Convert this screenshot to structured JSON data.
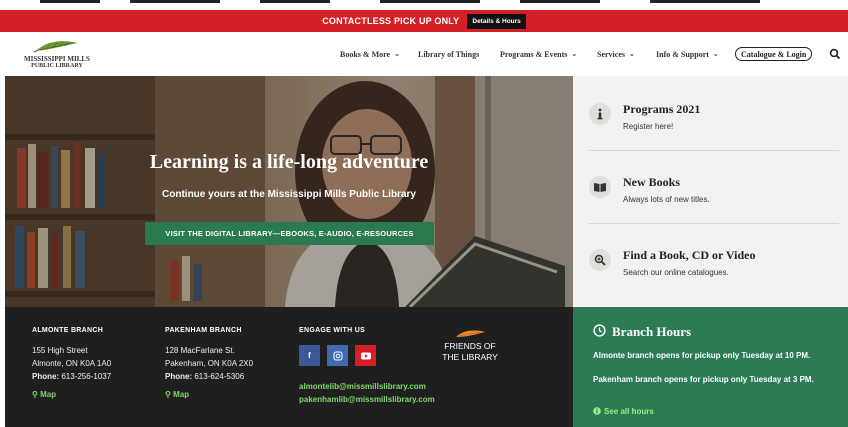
{
  "alert": {
    "message": "CONTACTLESS PICK UP ONLY",
    "button": "Details & Hours"
  },
  "logo": {
    "line1": "MISSISSIPPI MILLS",
    "line2": "PUBLIC LIBRARY"
  },
  "nav": {
    "items": [
      {
        "label": "Books & More",
        "dropdown": true
      },
      {
        "label": "Library of Things",
        "dropdown": false
      },
      {
        "label": "Programs & Events",
        "dropdown": true
      },
      {
        "label": "Services",
        "dropdown": true
      },
      {
        "label": "Info & Support",
        "dropdown": true
      }
    ],
    "catalogue": "Catalogue & Login",
    "search_icon": "search-icon"
  },
  "hero": {
    "title": "Learning is a life-long adventure",
    "subtitle": "Continue yours at the Mississippi Mills Public Library",
    "button": "VISIT THE DIGITAL LIBRARY—EBOOKS, E-AUDIO, E-RESOURCES"
  },
  "side": {
    "items": [
      {
        "title": "Programs 2021",
        "desc": "Register here!",
        "icon": "info-icon"
      },
      {
        "title": "New Books",
        "desc": "Always lots of new titles.",
        "icon": "book-icon"
      },
      {
        "title": "Find a Book, CD or Video",
        "desc": "Search our online catalogues.",
        "icon": "zoom-icon"
      }
    ]
  },
  "footer": {
    "almonte": {
      "heading": "ALMONTE BRANCH",
      "address1": "155 High Street",
      "address2": "Almonte, ON K0A 1A0",
      "phone_label": "Phone:",
      "phone": "613-256-1037",
      "map": "Map"
    },
    "pakenham": {
      "heading": "PAKENHAM BRANCH",
      "address1": "128 MacFarlane St.",
      "address2": "Pakenham, ON K0A 2X0",
      "phone_label": "Phone:",
      "phone": "613-624-5306",
      "map": "Map"
    },
    "engage": {
      "heading": "ENGAGE WITH US",
      "facebook": "f",
      "email1": "almontelib@missmillslibrary.com",
      "email2": "pakenhamlib@missmillslibrary.com"
    },
    "friends": {
      "line1": "FRIENDS OF",
      "line2": "THE LIBRARY"
    }
  },
  "hours": {
    "title": "Branch Hours",
    "line1": "Almonte branch opens for pickup only Tuesday at 10 PM.",
    "line2": "Pakenham branch opens for pickup only Tuesday at 3 PM.",
    "see_all": "See all hours"
  },
  "colors": {
    "alert": "#d51f26",
    "green": "#2b7c52",
    "facebook": "#3b5998",
    "instagram": "#3f6ab0",
    "youtube": "#d51f26"
  }
}
